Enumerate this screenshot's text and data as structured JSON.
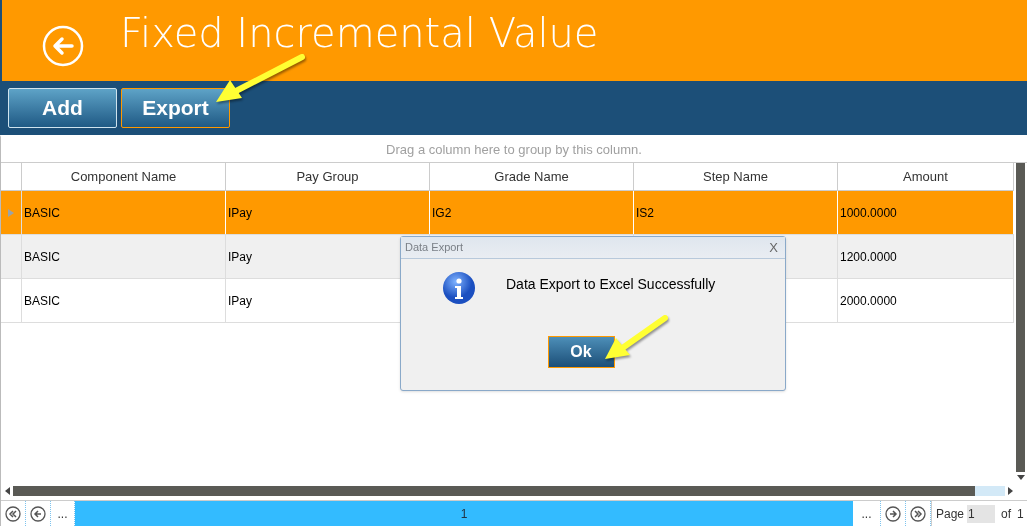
{
  "header": {
    "title": "Fixed Incremental Value"
  },
  "toolbar": {
    "buttons": [
      {
        "label": "Add",
        "focused": false
      },
      {
        "label": "Export",
        "focused": true
      }
    ]
  },
  "grid": {
    "group_hint": "Drag a column here to group by this column.",
    "columns": [
      "Component Name",
      "Pay Group",
      "Grade Name",
      "Step Name",
      "Amount"
    ],
    "rows": [
      {
        "selected": true,
        "cells": [
          "BASIC",
          "IPay",
          "IG2",
          "IS2",
          "1000.0000"
        ]
      },
      {
        "selected": false,
        "cells": [
          "BASIC",
          "IPay",
          null,
          null,
          "1200.0000"
        ]
      },
      {
        "selected": false,
        "cells": [
          "BASIC",
          "IPay",
          null,
          null,
          "2000.0000"
        ]
      }
    ]
  },
  "pager": {
    "first_ellipsis": "...",
    "pages": [
      {
        "label": "1",
        "selected": true
      }
    ],
    "last_ellipsis": "...",
    "page_label": "Page",
    "page_value": "1",
    "of_label": "of",
    "total": "1"
  },
  "dialog": {
    "title": "Data Export",
    "close": "X",
    "message": "Data Export to Excel Successfully",
    "button": "Ok"
  }
}
